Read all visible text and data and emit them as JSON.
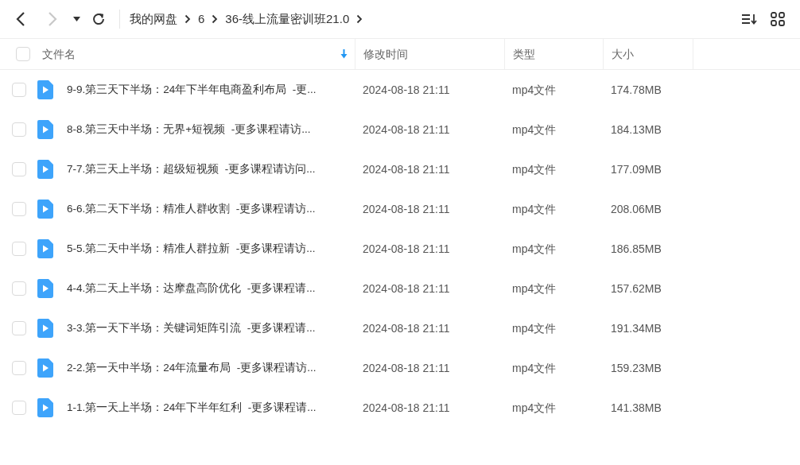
{
  "toolbar": {
    "back": {
      "disabled": false
    },
    "forward": {
      "disabled": true
    },
    "breadcrumbs": [
      "我的网盘",
      "6",
      "36-线上流量密训班21.0"
    ]
  },
  "table": {
    "select_all": {
      "checked": false
    },
    "columns": [
      {
        "label": "文件名",
        "sorted": true
      },
      {
        "label": "修改时间",
        "sorted": false
      },
      {
        "label": "类型",
        "sorted": false
      },
      {
        "label": "大小",
        "sorted": false
      }
    ],
    "rows": [
      {
        "checked": false,
        "name": "9-9.第三天下半场：24年下半年电商盈利布局  -更...",
        "modified": "2024-08-18 21:11",
        "type": "mp4文件",
        "size": "174.78MB"
      },
      {
        "checked": false,
        "name": "8-8.第三天中半场：无界+短视频  -更多课程请访...",
        "modified": "2024-08-18 21:11",
        "type": "mp4文件",
        "size": "184.13MB"
      },
      {
        "checked": false,
        "name": "7-7.第三天上半场：超级短视频  -更多课程请访问...",
        "modified": "2024-08-18 21:11",
        "type": "mp4文件",
        "size": "177.09MB"
      },
      {
        "checked": false,
        "name": "6-6.第二天下半场：精准人群收割  -更多课程请访...",
        "modified": "2024-08-18 21:11",
        "type": "mp4文件",
        "size": "208.06MB"
      },
      {
        "checked": false,
        "name": "5-5.第二天中半场：精准人群拉新  -更多课程请访...",
        "modified": "2024-08-18 21:11",
        "type": "mp4文件",
        "size": "186.85MB"
      },
      {
        "checked": false,
        "name": "4-4.第二天上半场：达摩盘高阶优化  -更多课程请...",
        "modified": "2024-08-18 21:11",
        "type": "mp4文件",
        "size": "157.62MB"
      },
      {
        "checked": false,
        "name": "3-3.第一天下半场：关键词矩阵引流  -更多课程请...",
        "modified": "2024-08-18 21:11",
        "type": "mp4文件",
        "size": "191.34MB"
      },
      {
        "checked": false,
        "name": "2-2.第一天中半场：24年流量布局  -更多课程请访...",
        "modified": "2024-08-18 21:11",
        "type": "mp4文件",
        "size": "159.23MB"
      },
      {
        "checked": false,
        "name": "1-1.第一天上半场：24年下半年红利  -更多课程请...",
        "modified": "2024-08-18 21:11",
        "type": "mp4文件",
        "size": "141.38MB"
      }
    ]
  }
}
